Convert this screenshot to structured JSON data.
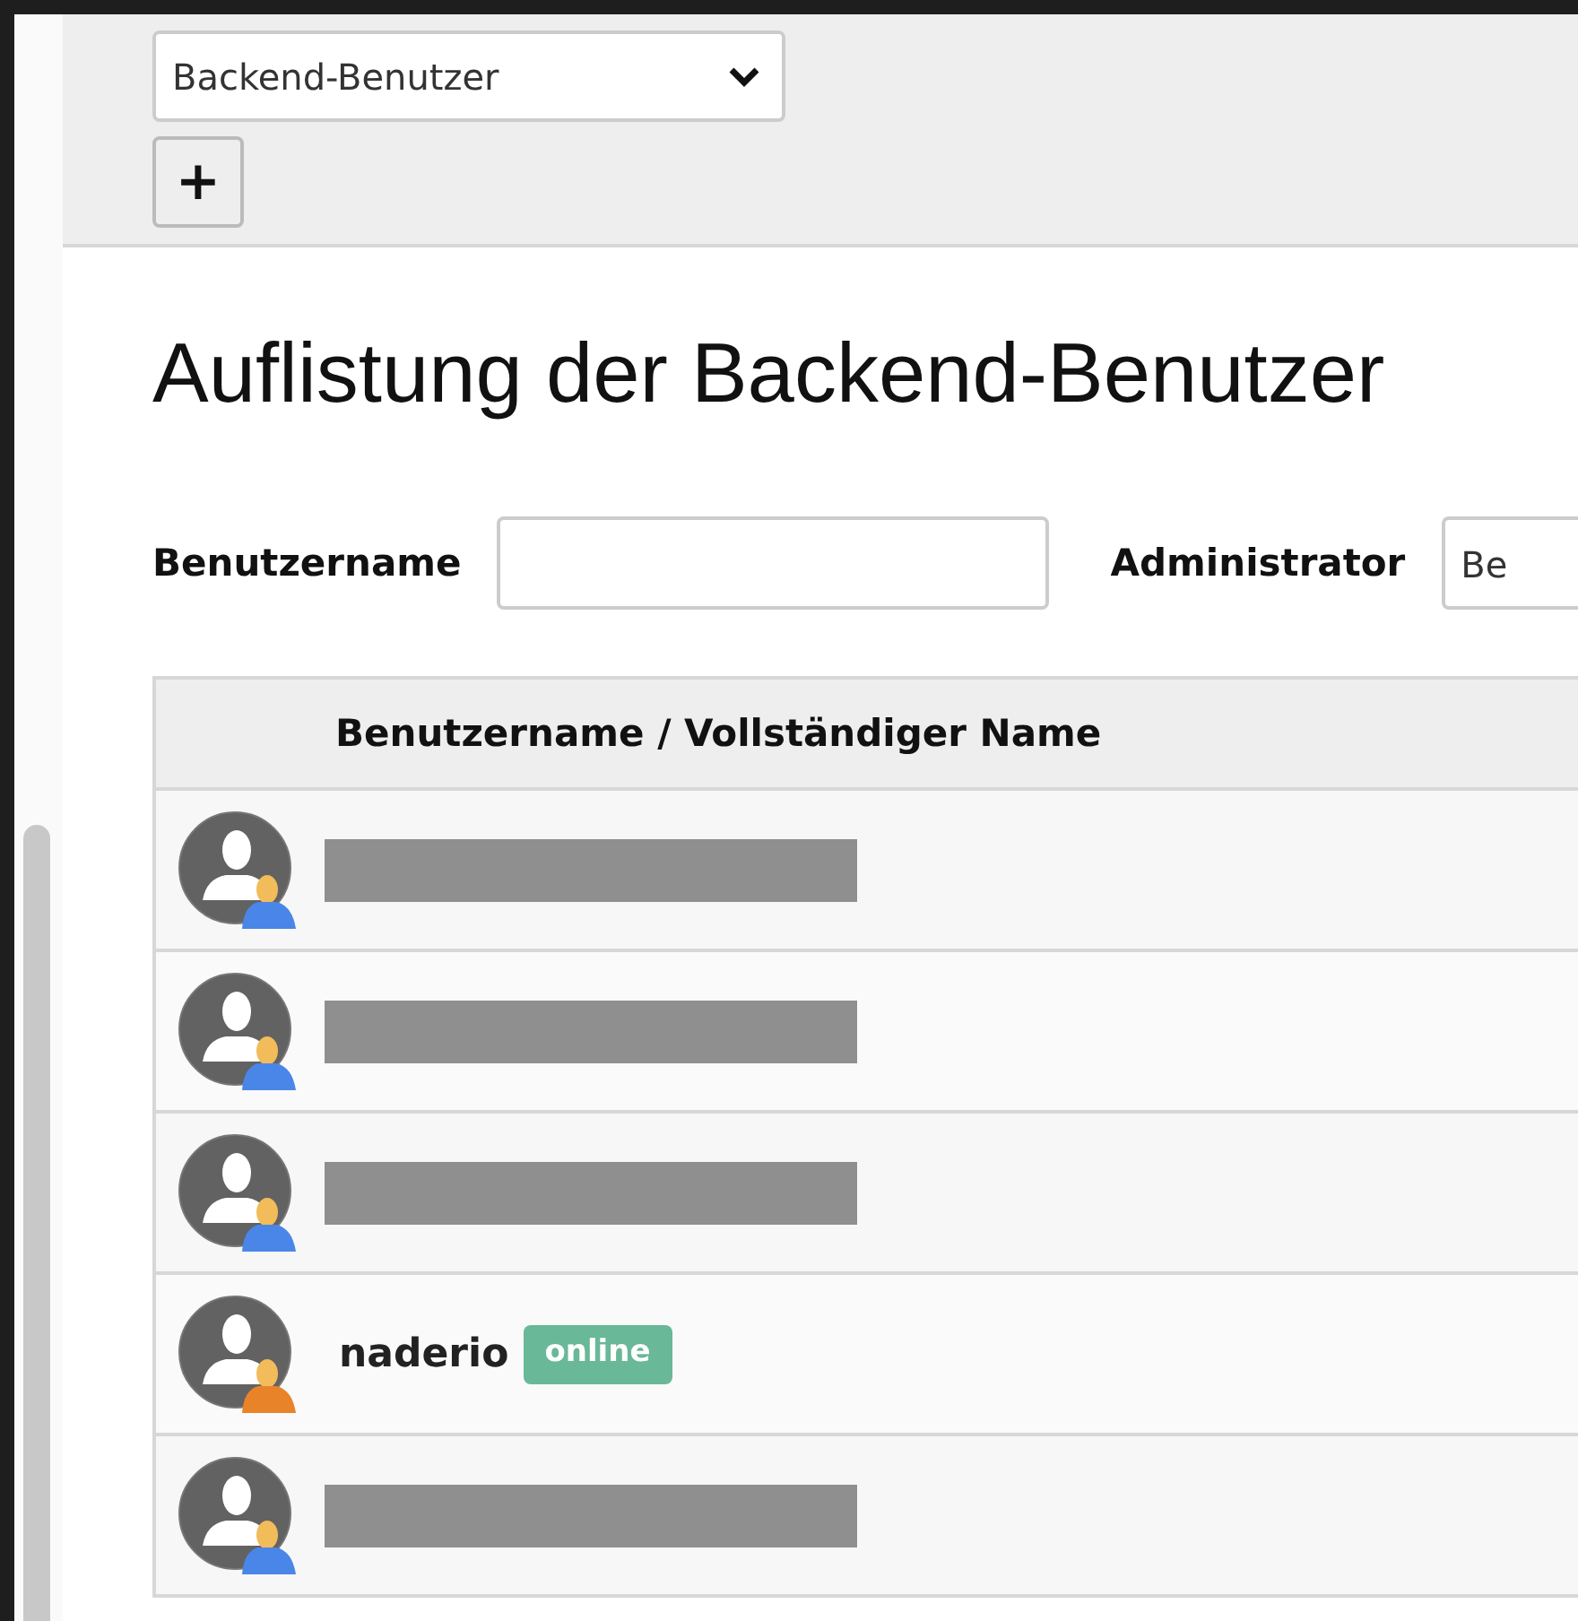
{
  "module_select": {
    "value": "Backend-Benutzer"
  },
  "add_button": {
    "label": "+"
  },
  "title": "Auflistung der Backend-Benutzer",
  "filters": [
    {
      "label": "Benutzername"
    },
    {
      "label": "Administrator",
      "value": "Be"
    }
  ],
  "table": {
    "columns": [
      "Benutzername / Vollständiger Name"
    ],
    "rows": [
      {
        "kind": "redacted",
        "color": "#4a86e8"
      },
      {
        "kind": "redacted",
        "color": "#4a86e8"
      },
      {
        "kind": "redacted",
        "color": "#4a86e8"
      },
      {
        "kind": "user",
        "name": "naderio",
        "status": "online",
        "color": "#e8832a"
      },
      {
        "kind": "redacted",
        "color": "#4a86e8"
      }
    ]
  }
}
